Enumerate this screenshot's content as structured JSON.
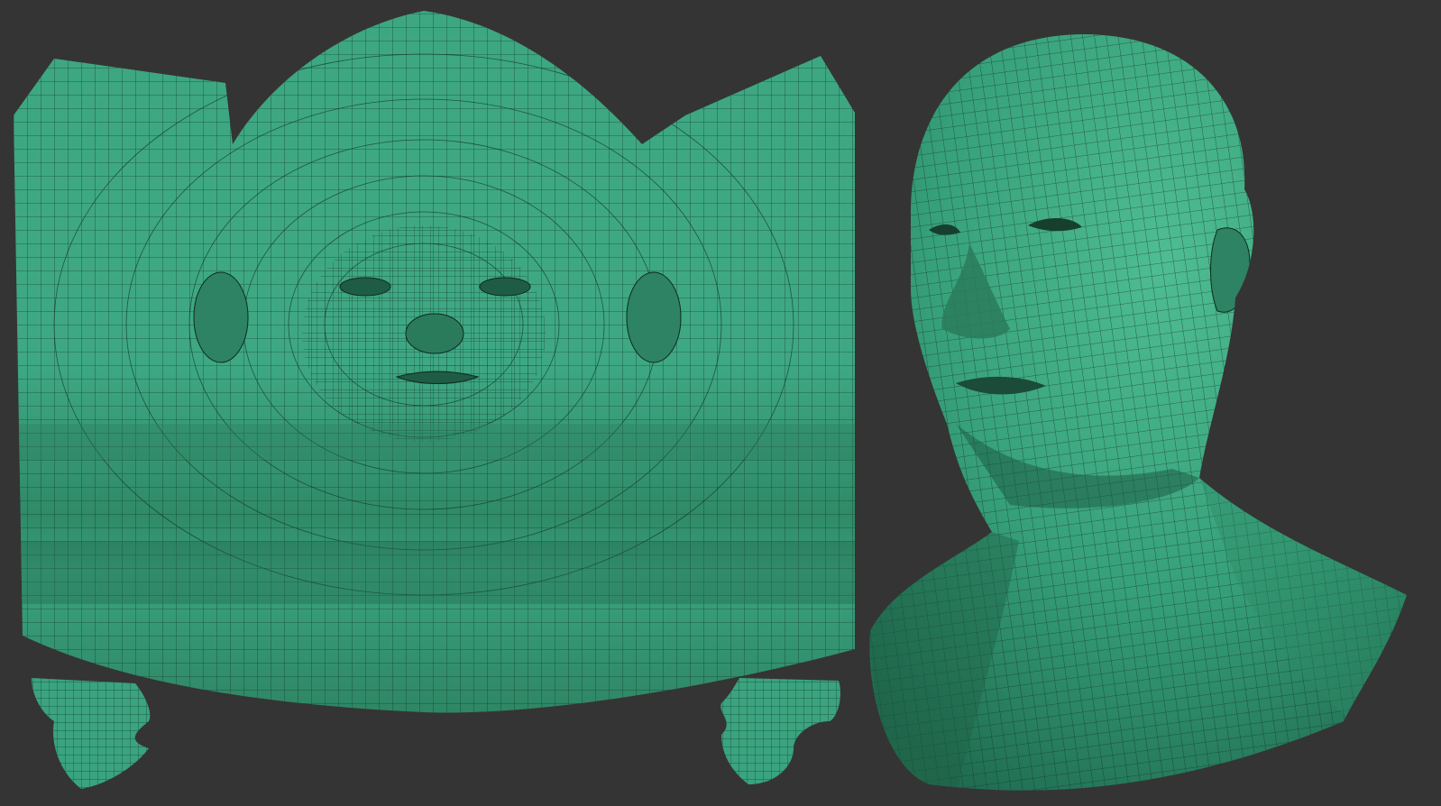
{
  "scene": {
    "background_color": "#343434",
    "mesh_color": "#3aa37f",
    "mesh_highlight_color": "#55c79c",
    "mesh_shadow_color": "#23694f",
    "wire_color": "#133326"
  },
  "objects": [
    {
      "name": "uv-layout-face-unwrap",
      "kind": "flattened UV layout of head mesh"
    },
    {
      "name": "uv-island-left-piece",
      "kind": "small UV island"
    },
    {
      "name": "uv-island-right-piece",
      "kind": "small UV island"
    },
    {
      "name": "head-bust-mesh",
      "kind": "3D head and neck with wireframe"
    }
  ]
}
